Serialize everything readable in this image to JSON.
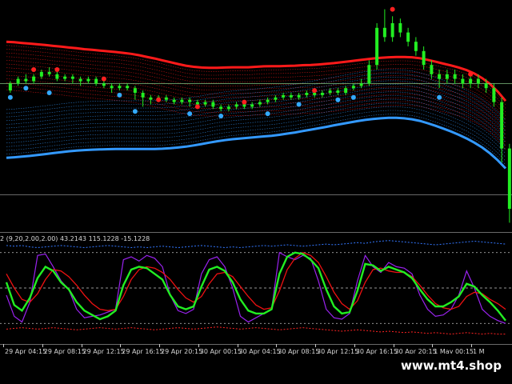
{
  "chart_data": [
    {
      "type": "line",
      "pane": "price",
      "title": "",
      "ylabel": "",
      "ylim": [
        0,
        100
      ],
      "x": [
        0,
        1,
        2,
        3,
        4,
        5,
        6,
        7,
        8,
        9,
        10,
        11,
        12,
        13,
        14,
        15,
        16,
        17,
        18,
        19,
        20,
        21,
        22,
        23,
        24,
        25,
        26,
        27,
        28,
        29,
        30,
        31,
        32,
        33,
        34,
        35,
        36,
        37,
        38,
        39,
        40,
        41,
        42,
        43,
        44,
        45,
        46,
        47,
        48,
        49,
        50,
        51,
        52,
        53,
        54,
        55,
        56,
        57,
        58,
        59,
        60,
        61,
        62,
        63,
        64
      ],
      "bands": {
        "upper_count": 14,
        "lower_count": 14,
        "upper_color": "#ff1a1a",
        "lower_color": "#3399ff",
        "spacing": 1.6,
        "upper_base": [
          82,
          81.8,
          81.5,
          81.2,
          80.9,
          80.6,
          80.2,
          79.9,
          79.5,
          79.2,
          78.8,
          78.5,
          78.2,
          77.9,
          77.6,
          77.2,
          76.8,
          76.2,
          75.5,
          74.8,
          74,
          73.2,
          72.4,
          71.7,
          71.2,
          70.9,
          70.8,
          70.8,
          70.9,
          71,
          71,
          71,
          71.2,
          71.4,
          71.5,
          71.5,
          71.6,
          71.7,
          71.9,
          72,
          72.2,
          72.5,
          72.8,
          73.2,
          73.6,
          74,
          74.4,
          74.8,
          75.1,
          75.3,
          75.4,
          75.4,
          75.3,
          74.9,
          74.2,
          73.4,
          72.6,
          71.8,
          70.9,
          69.8,
          68.3,
          66.3,
          63.8,
          60.5,
          56.5
        ],
        "lower_base": [
          32,
          32.2,
          32.5,
          32.8,
          33.2,
          33.6,
          34,
          34.4,
          34.8,
          35.1,
          35.3,
          35.5,
          35.6,
          35.7,
          35.8,
          35.8,
          35.8,
          35.8,
          35.8,
          35.8,
          35.9,
          36.1,
          36.4,
          36.8,
          37.3,
          37.9,
          38.5,
          39.1,
          39.6,
          40,
          40.3,
          40.6,
          40.9,
          41.2,
          41.5,
          41.9,
          42.4,
          42.9,
          43.5,
          44.1,
          44.7,
          45.3,
          46,
          46.6,
          47.2,
          47.8,
          48.3,
          48.7,
          49,
          49.2,
          49.2,
          49,
          48.6,
          47.9,
          46.9,
          45.8,
          44.6,
          43.3,
          41.9,
          40.3,
          38.5,
          36.4,
          33.9,
          30.9,
          27.4
        ]
      },
      "baseline": {
        "value": 64,
        "color": "#80c080"
      },
      "hline": {
        "value": 16,
        "color": "#8a8a8a"
      },
      "candles": [
        [
          61,
          64,
          60,
          65
        ],
        [
          64,
          66,
          63,
          67
        ],
        [
          66,
          65,
          64,
          68
        ],
        [
          65,
          67,
          64,
          68
        ],
        [
          67,
          69,
          66,
          70
        ],
        [
          69,
          68,
          67,
          71
        ],
        [
          68,
          66,
          65,
          69
        ],
        [
          66,
          67,
          65,
          68
        ],
        [
          67,
          66,
          64,
          68
        ],
        [
          66,
          65,
          63,
          67
        ],
        [
          65,
          66,
          64,
          67
        ],
        [
          66,
          64,
          63,
          67
        ],
        [
          64,
          63,
          62,
          65
        ],
        [
          63,
          62,
          60,
          64
        ],
        [
          62,
          63,
          61,
          64
        ],
        [
          63,
          62,
          61,
          64
        ],
        [
          62,
          60,
          57,
          63
        ],
        [
          60,
          58,
          54,
          61
        ],
        [
          58,
          57,
          55,
          59
        ],
        [
          57,
          58,
          56,
          59
        ],
        [
          58,
          57,
          56,
          59
        ],
        [
          57,
          56,
          55,
          58
        ],
        [
          56,
          57,
          55,
          58
        ],
        [
          57,
          56,
          54,
          58
        ],
        [
          56,
          55,
          54,
          57
        ],
        [
          55,
          56,
          54,
          57
        ],
        [
          56,
          54,
          53,
          57
        ],
        [
          54,
          53,
          52,
          55
        ],
        [
          53,
          54,
          52,
          55
        ],
        [
          54,
          55,
          53,
          56
        ],
        [
          55,
          54,
          53,
          56
        ],
        [
          54,
          55,
          53,
          56
        ],
        [
          55,
          56,
          54,
          57
        ],
        [
          56,
          57,
          55,
          58
        ],
        [
          57,
          58,
          56,
          59
        ],
        [
          58,
          59,
          57,
          60
        ],
        [
          59,
          58,
          57,
          60
        ],
        [
          58,
          59,
          57,
          60
        ],
        [
          59,
          60,
          58,
          61
        ],
        [
          60,
          59,
          58,
          61
        ],
        [
          59,
          60,
          58,
          61
        ],
        [
          60,
          61,
          59,
          62
        ],
        [
          61,
          60,
          59,
          62
        ],
        [
          60,
          62,
          59,
          63
        ],
        [
          62,
          63,
          61,
          64
        ],
        [
          63,
          64,
          62,
          66
        ],
        [
          64,
          72,
          63,
          74
        ],
        [
          72,
          88,
          70,
          90
        ],
        [
          88,
          84,
          82,
          96
        ],
        [
          84,
          90,
          82,
          93
        ],
        [
          90,
          86,
          84,
          92
        ],
        [
          86,
          82,
          80,
          88
        ],
        [
          82,
          78,
          76,
          84
        ],
        [
          78,
          72,
          70,
          80
        ],
        [
          72,
          68,
          66,
          74
        ],
        [
          68,
          66,
          62,
          70
        ],
        [
          66,
          68,
          64,
          70
        ],
        [
          68,
          66,
          64,
          70
        ],
        [
          66,
          64,
          62,
          68
        ],
        [
          64,
          66,
          62,
          67
        ],
        [
          66,
          64,
          62,
          68
        ],
        [
          64,
          62,
          60,
          66
        ],
        [
          62,
          56,
          54,
          64
        ],
        [
          56,
          36,
          30,
          58
        ],
        [
          36,
          10,
          4,
          38
        ]
      ],
      "up_color": "#22ee22",
      "down_color": "#22ee22",
      "signals": [
        {
          "x": 3,
          "y": 70,
          "color": "#ff2020"
        },
        {
          "x": 6,
          "y": 70,
          "color": "#ff2020"
        },
        {
          "x": 12,
          "y": 66,
          "color": "#ff2020"
        },
        {
          "x": 19,
          "y": 57,
          "color": "#ff2020"
        },
        {
          "x": 24,
          "y": 54,
          "color": "#ff2020"
        },
        {
          "x": 30,
          "y": 56,
          "color": "#ff2020"
        },
        {
          "x": 39,
          "y": 61,
          "color": "#ff2020"
        },
        {
          "x": 49,
          "y": 96,
          "color": "#ff2020"
        },
        {
          "x": 59,
          "y": 68,
          "color": "#ff2020"
        },
        {
          "x": 0,
          "y": 58,
          "color": "#33aaff"
        },
        {
          "x": 2,
          "y": 62,
          "color": "#33aaff"
        },
        {
          "x": 5,
          "y": 60,
          "color": "#33aaff"
        },
        {
          "x": 14,
          "y": 59,
          "color": "#33aaff"
        },
        {
          "x": 16,
          "y": 52,
          "color": "#33aaff"
        },
        {
          "x": 23,
          "y": 51,
          "color": "#33aaff"
        },
        {
          "x": 27,
          "y": 50,
          "color": "#33aaff"
        },
        {
          "x": 33,
          "y": 51,
          "color": "#33aaff"
        },
        {
          "x": 37,
          "y": 55,
          "color": "#33aaff"
        },
        {
          "x": 42,
          "y": 57,
          "color": "#33aaff"
        },
        {
          "x": 44,
          "y": 58,
          "color": "#33aaff"
        },
        {
          "x": 55,
          "y": 58,
          "color": "#33aaff"
        }
      ]
    },
    {
      "type": "line",
      "pane": "indicator",
      "title": "2 (9,20,2.00,2.00) 43.2143 115.1228 -15.1228",
      "ylim": [
        -20,
        120
      ],
      "x": [
        0,
        1,
        2,
        3,
        4,
        5,
        6,
        7,
        8,
        9,
        10,
        11,
        12,
        13,
        14,
        15,
        16,
        17,
        18,
        19,
        20,
        21,
        22,
        23,
        24,
        25,
        26,
        27,
        28,
        29,
        30,
        31,
        32,
        33,
        34,
        35,
        36,
        37,
        38,
        39,
        40,
        41,
        42,
        43,
        44,
        45,
        46,
        47,
        48,
        49,
        50,
        51,
        52,
        53,
        54,
        55,
        56,
        57,
        58,
        59,
        60,
        61,
        62,
        63,
        64
      ],
      "levels": [
        {
          "value": 50,
          "color": "#c8c8c8",
          "dash": "3,3"
        },
        {
          "value": 100,
          "color": "#c8c8c8",
          "dash": "2,3"
        },
        {
          "value": 0,
          "color": "#c8c8c8",
          "dash": "2,3"
        }
      ],
      "band_lines": [
        {
          "name": "upper",
          "color": "#3377ff",
          "dash": "2,2",
          "values": [
            110,
            109,
            110,
            108,
            107,
            108,
            109,
            110,
            109,
            108,
            107,
            108,
            109,
            110,
            109,
            108,
            107,
            108,
            107,
            108,
            109,
            108,
            107,
            108,
            109,
            110,
            109,
            108,
            107,
            108,
            107,
            108,
            109,
            110,
            109,
            110,
            111,
            110,
            109,
            110,
            111,
            112,
            111,
            112,
            113,
            114,
            113,
            115,
            116,
            117,
            116,
            115,
            114,
            113,
            112,
            111,
            112,
            113,
            114,
            115,
            116,
            115,
            114,
            113,
            112
          ]
        },
        {
          "name": "lower",
          "color": "#ff2222",
          "dash": "2,2",
          "values": [
            -8,
            -7,
            -6,
            -7,
            -8,
            -7,
            -6,
            -7,
            -8,
            -9,
            -8,
            -7,
            -6,
            -7,
            -8,
            -7,
            -6,
            -7,
            -8,
            -9,
            -8,
            -7,
            -6,
            -7,
            -8,
            -7,
            -6,
            -5,
            -6,
            -7,
            -8,
            -7,
            -6,
            -7,
            -8,
            -9,
            -8,
            -7,
            -6,
            -7,
            -8,
            -9,
            -10,
            -11,
            -10,
            -9,
            -10,
            -11,
            -12,
            -11,
            -12,
            -13,
            -12,
            -13,
            -14,
            -13,
            -14,
            -15,
            -14,
            -13,
            -14,
            -15,
            -14,
            -15,
            -15
          ]
        }
      ],
      "series": [
        {
          "color": "#9922ee",
          "width": 1.2,
          "values": [
            40,
            10,
            2,
            30,
            96,
            98,
            80,
            60,
            48,
            20,
            8,
            10,
            12,
            16,
            20,
            90,
            94,
            88,
            96,
            92,
            80,
            40,
            18,
            14,
            20,
            70,
            90,
            94,
            80,
            50,
            10,
            2,
            8,
            14,
            20,
            100,
            94,
            90,
            96,
            92,
            60,
            20,
            8,
            6,
            14,
            60,
            96,
            80,
            72,
            86,
            80,
            78,
            70,
            40,
            20,
            10,
            12,
            20,
            40,
            74,
            50,
            20,
            10,
            4,
            0
          ]
        },
        {
          "color": "#ee1111",
          "width": 1.3,
          "values": [
            70,
            50,
            34,
            30,
            42,
            62,
            76,
            74,
            66,
            54,
            40,
            28,
            20,
            18,
            20,
            38,
            62,
            76,
            80,
            78,
            72,
            62,
            48,
            36,
            30,
            38,
            56,
            70,
            72,
            66,
            52,
            38,
            26,
            20,
            22,
            46,
            76,
            92,
            100,
            96,
            86,
            66,
            44,
            28,
            20,
            32,
            58,
            76,
            78,
            74,
            72,
            72,
            66,
            54,
            40,
            28,
            22,
            20,
            24,
            38,
            44,
            42,
            34,
            28,
            20
          ]
        },
        {
          "color": "#22ee22",
          "width": 2.4,
          "values": [
            58,
            26,
            18,
            36,
            64,
            80,
            74,
            58,
            48,
            30,
            18,
            12,
            6,
            10,
            18,
            54,
            76,
            80,
            78,
            70,
            62,
            40,
            24,
            20,
            24,
            52,
            76,
            80,
            74,
            58,
            34,
            18,
            14,
            14,
            20,
            70,
            94,
            100,
            98,
            90,
            78,
            48,
            24,
            14,
            16,
            46,
            84,
            82,
            74,
            80,
            76,
            72,
            64,
            48,
            34,
            24,
            24,
            30,
            38,
            56,
            52,
            40,
            30,
            18,
            4
          ]
        }
      ]
    }
  ],
  "time_axis": [
    {
      "x": 0,
      "label": "29 Apr 04:15"
    },
    {
      "x": 5,
      "label": "29 Apr 08:15"
    },
    {
      "x": 10,
      "label": "29 Apr 12:15"
    },
    {
      "x": 15,
      "label": "29 Apr 16:15"
    },
    {
      "x": 20,
      "label": "29 Apr 20:15"
    },
    {
      "x": 25,
      "label": "30 Apr 00:15"
    },
    {
      "x": 30,
      "label": "30 Apr 04:15"
    },
    {
      "x": 35,
      "label": "30 Apr 08:15"
    },
    {
      "x": 40,
      "label": "30 Apr 12:15"
    },
    {
      "x": 45,
      "label": "30 Apr 16:15"
    },
    {
      "x": 50,
      "label": "30 Apr 20:15"
    },
    {
      "x": 55,
      "label": "1 May 00:15"
    },
    {
      "x": 60,
      "label": "1 M"
    }
  ],
  "watermark": "www.mt4.shop"
}
